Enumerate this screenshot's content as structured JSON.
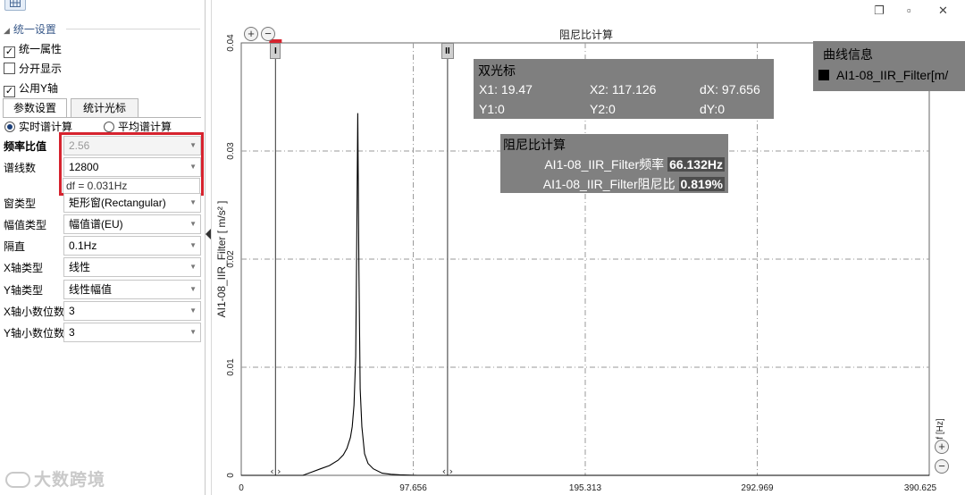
{
  "left_panel": {
    "section_title": "统一设置",
    "checkboxes": [
      {
        "label": "统一属性",
        "checked": true
      },
      {
        "label": "分开显示",
        "checked": false
      },
      {
        "label": "公用Y轴",
        "checked": true
      }
    ],
    "tabs": [
      {
        "label": "参数设置",
        "active": true
      },
      {
        "label": "统计光标",
        "active": false
      }
    ],
    "radios": [
      {
        "label": "实时谱计算",
        "selected": true
      },
      {
        "label": "平均谱计算",
        "selected": false
      }
    ],
    "properties": [
      {
        "label": "频率比值",
        "value": "2.56",
        "disabled": true
      },
      {
        "label": "谱线数",
        "value": "12800",
        "disabled": false
      },
      {
        "label": "窗类型",
        "value": "矩形窗(Rectangular)",
        "disabled": false
      },
      {
        "label": "幅值类型",
        "value": "幅值谱(EU)",
        "disabled": false
      },
      {
        "label": "隔直",
        "value": "0.1Hz",
        "disabled": false
      },
      {
        "label": "X轴类型",
        "value": "线性",
        "disabled": false
      },
      {
        "label": "Y轴类型",
        "value": "线性幅值",
        "disabled": false
      },
      {
        "label": "X轴小数位数",
        "value": "3",
        "disabled": false
      },
      {
        "label": "Y轴小数位数",
        "value": "3",
        "disabled": false
      }
    ],
    "hint": "df = 0.031Hz",
    "highlight_color": "#d6232e"
  },
  "window_buttons": [
    "restore-icon",
    "maximize-icon",
    "close-icon"
  ],
  "window_glyphs": {
    "restore": "❐",
    "maximize": "▫",
    "close": "✕"
  },
  "zoom_glyphs": {
    "plus": "+",
    "minus": "−"
  },
  "watermark": "大数跨境",
  "chart": {
    "title": "阻尼比计算",
    "cursor_labels": [
      "I",
      "II"
    ],
    "dual_cursor": {
      "title": "双光标",
      "x1": "X1:  19.47",
      "x2": "X2:  117.126",
      "dx": "dX: 97.656",
      "y1": "Y1:0",
      "y2": "Y2:0",
      "dy": "dY:0"
    },
    "damping": {
      "title": "阻尼比计算",
      "freq_label": "AI1-08_IIR_Filter频率",
      "freq_value": "66.132Hz",
      "ratio_label": "AI1-08_IIR_Filter阻尼比",
      "ratio_value": "0.819%"
    },
    "curve_info": {
      "title": "曲线信息",
      "item": "AI1-08_IIR_Filter[m/"
    },
    "ylabel": "AI1-08_IIR_Filter  [ m/s² ]",
    "xunit": "f [Hz]"
  },
  "chart_data": {
    "type": "line",
    "title": "阻尼比计算",
    "xlabel": "f [Hz]",
    "ylabel": "AI1-08_IIR_Filter  [ m/s² ]",
    "xlim": [
      0,
      390.625
    ],
    "ylim": [
      0,
      0.04
    ],
    "x_ticks": [
      "0",
      "97.656",
      "195.313",
      "292.969",
      "390.625"
    ],
    "y_ticks": [
      "0",
      "0.01",
      "0.02",
      "0.03",
      "0.04"
    ],
    "grid": true,
    "cursors": [
      19.47,
      117.126
    ],
    "series": [
      {
        "x": [
          0,
          20,
          35,
          40,
          45,
          50,
          55,
          58,
          60,
          62,
          63,
          64,
          65,
          65.5,
          66.132,
          66.8,
          67.5,
          68.5,
          70,
          72,
          75,
          80,
          85,
          90,
          100,
          390.625
        ],
        "y": [
          0,
          0,
          0,
          0.0003,
          0.0006,
          0.0009,
          0.0014,
          0.0019,
          0.0025,
          0.0035,
          0.0045,
          0.0065,
          0.011,
          0.02,
          0.0335,
          0.019,
          0.008,
          0.0045,
          0.002,
          0.0011,
          0.0006,
          0.0002,
          0.0001,
          5e-05,
          0,
          0
        ]
      }
    ]
  }
}
